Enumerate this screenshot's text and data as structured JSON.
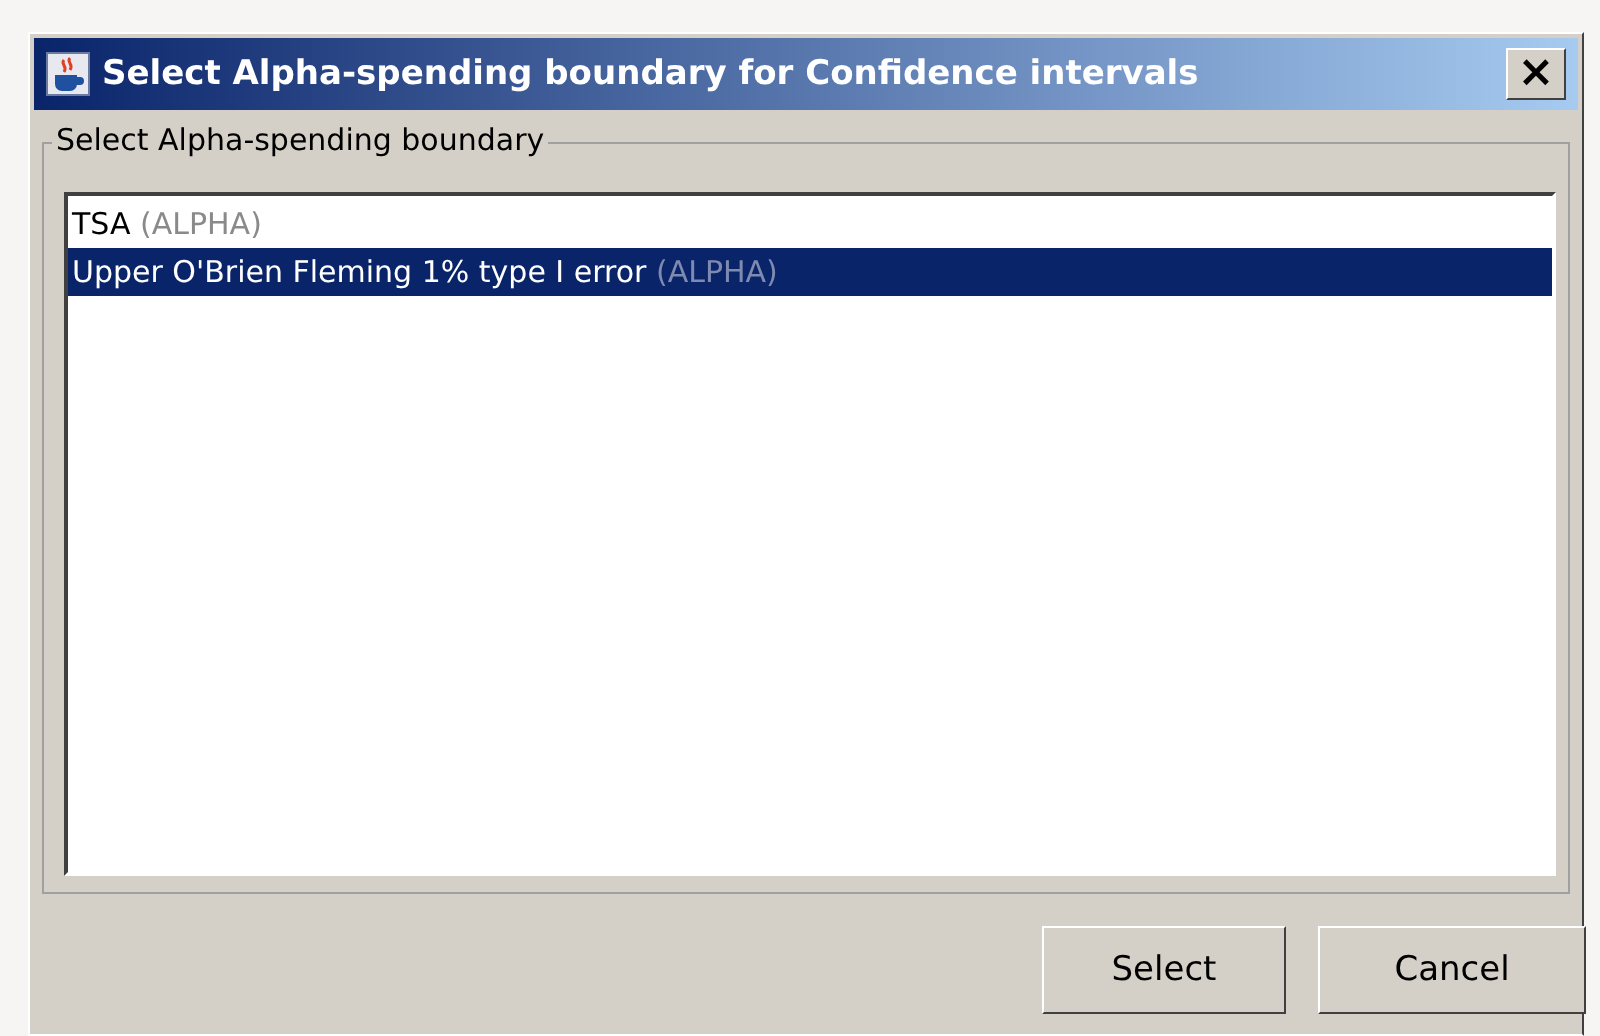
{
  "window": {
    "title": "Select Alpha-spending boundary for Confidence intervals",
    "close": "×"
  },
  "group": {
    "title": "Select Alpha-spending boundary"
  },
  "list": [
    {
      "name": "TSA",
      "tag": "(ALPHA)",
      "selected": false
    },
    {
      "name": "Upper O'Brien Fleming 1% type I error",
      "tag": "(ALPHA)",
      "selected": true
    }
  ],
  "buttons": [
    "Select",
    "Cancel"
  ]
}
